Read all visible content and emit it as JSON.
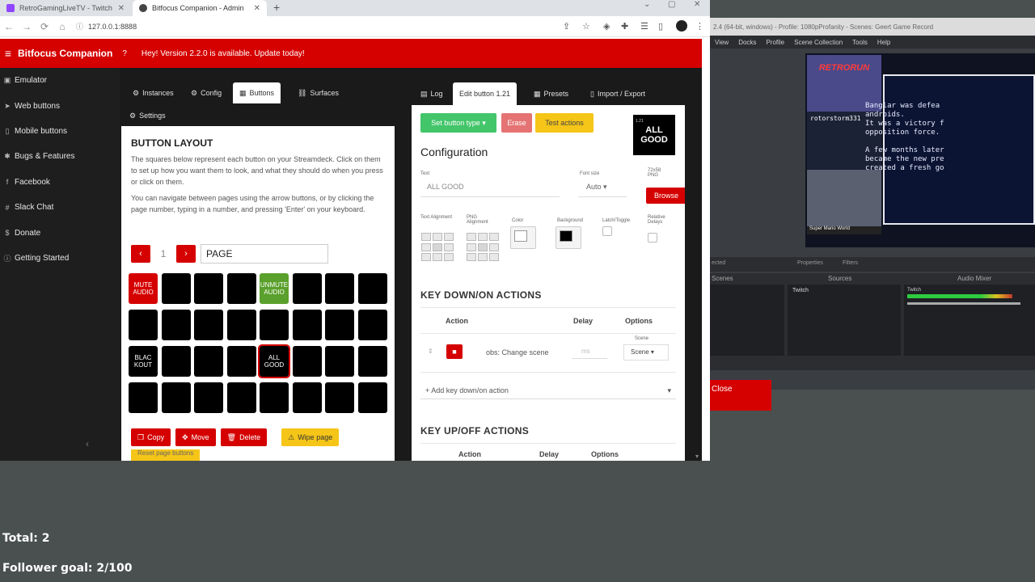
{
  "browser": {
    "tabs": [
      {
        "label": "RetroGamingLiveTV - Twitch",
        "favicon_color": "#9146ff"
      },
      {
        "label": "Bitfocus Companion - Admin",
        "favicon_color": "#444444"
      }
    ],
    "url": "127.0.0.1:8888"
  },
  "app": {
    "title": "Bitfocus Companion",
    "help": "?",
    "update_msg": "Hey! Version 2.2.0 is available. Update today!",
    "accent": "#d50000"
  },
  "sidebar": {
    "items": [
      {
        "label": "Emulator",
        "icon": "gamepad-icon"
      },
      {
        "label": "Web buttons",
        "icon": "pointer-icon"
      },
      {
        "label": "Mobile buttons",
        "icon": "mobile-icon"
      },
      {
        "label": "Bugs & Features",
        "icon": "bug-icon"
      },
      {
        "label": "Facebook",
        "icon": "facebook-icon"
      },
      {
        "label": "Slack Chat",
        "icon": "slack-icon"
      },
      {
        "label": "Donate",
        "icon": "dollar-icon"
      },
      {
        "label": "Getting Started",
        "icon": "info-icon"
      }
    ]
  },
  "left_tabs": {
    "instances": "Instances",
    "config": "Config",
    "buttons": "Buttons",
    "surfaces": "Surfaces",
    "settings": "Settings"
  },
  "button_layout": {
    "title": "BUTTON LAYOUT",
    "text1": "The squares below represent each button on your Streamdeck. Click on them to set up how you want them to look, and what they should do when you press or click on them.",
    "text2": "You can navigate between pages using the arrow buttons, or by clicking the page number, typing in a number, and pressing 'Enter' on your keyboard.",
    "page_number": "1",
    "page_name": "PAGE",
    "buttons": [
      {
        "label": "MUTE\nAUDIO",
        "bg": "#d50000"
      },
      {
        "label": "",
        "bg": "#000000"
      },
      {
        "label": "",
        "bg": "#000000"
      },
      {
        "label": "",
        "bg": "#000000"
      },
      {
        "label": "UNMUTE\nAUDIO",
        "bg": "#5aa02c"
      },
      {
        "label": "",
        "bg": "#000000"
      },
      {
        "label": "",
        "bg": "#000000"
      },
      {
        "label": "",
        "bg": "#000000"
      },
      {
        "label": "",
        "bg": "#000000"
      },
      {
        "label": "",
        "bg": "#000000"
      },
      {
        "label": "",
        "bg": "#000000"
      },
      {
        "label": "",
        "bg": "#000000"
      },
      {
        "label": "",
        "bg": "#000000"
      },
      {
        "label": "",
        "bg": "#000000"
      },
      {
        "label": "",
        "bg": "#000000"
      },
      {
        "label": "",
        "bg": "#000000"
      },
      {
        "label": "BLAC\nKOUT",
        "bg": "#000000"
      },
      {
        "label": "",
        "bg": "#000000"
      },
      {
        "label": "",
        "bg": "#000000"
      },
      {
        "label": "",
        "bg": "#000000"
      },
      {
        "label": "ALL\nGOOD",
        "bg": "#000000"
      },
      {
        "label": "",
        "bg": "#000000"
      },
      {
        "label": "",
        "bg": "#000000"
      },
      {
        "label": "",
        "bg": "#000000"
      },
      {
        "label": "",
        "bg": "#000000"
      },
      {
        "label": "",
        "bg": "#000000"
      },
      {
        "label": "",
        "bg": "#000000"
      },
      {
        "label": "",
        "bg": "#000000"
      },
      {
        "label": "",
        "bg": "#000000"
      },
      {
        "label": "",
        "bg": "#000000"
      },
      {
        "label": "",
        "bg": "#000000"
      },
      {
        "label": "",
        "bg": "#000000"
      }
    ],
    "copy": "Copy",
    "move": "Move",
    "delete": "Delete",
    "wipe": "Wipe page",
    "reset": "Reset page buttons"
  },
  "right_tabs": {
    "log": "Log",
    "edit": "Edit button 1.21",
    "presets": "Presets",
    "import_export": "Import / Export"
  },
  "editor": {
    "set_type": "Set button type",
    "erase": "Erase",
    "test": "Test actions",
    "preview_label": "ALL GOOD",
    "preview_small": "1.21",
    "heading": "Configuration",
    "text_label": "Text",
    "text_value": "ALL GOOD",
    "font_size_label": "Font size",
    "font_size_value": "Auto",
    "png_label": "72x58 PNG",
    "browse": "Browse",
    "text_alignment": "Text Alignment",
    "png_alignment": "PNG Alignment",
    "color_label": "Color",
    "background_label": "Background",
    "latch_label": "Latch/Toggle",
    "relative_label": "Relative Delays",
    "color_value": "#ffffff",
    "background_value": "#000000",
    "key_down_heading": "KEY DOWN/ON ACTIONS",
    "col_action": "Action",
    "col_delay": "Delay",
    "col_options": "Options",
    "action_name": "obs: Change scene",
    "delay_placeholder": "ms",
    "scene_label": "Scene",
    "scene_value": "Scene",
    "add_key_down": "+ Add key down/on action",
    "key_up_heading": "KEY UP/OFF ACTIONS"
  },
  "obs": {
    "title": "2.4 (64-bit, windows) - Profile: 1080pProfanity - Scenes: Geert Game Record",
    "menu": [
      "View",
      "Docks",
      "Profile",
      "Scene Collection",
      "Tools",
      "Help"
    ],
    "logo_text": "RETRORUN",
    "chat_user": "rotorstorm331",
    "game_text": "Banglar was defea\nandroids.\nIt was a victory f\nopposition force.\n\nA few months later\nbecame the new pre\ncreated a fresh go",
    "bottom_game": "Super Mario World",
    "docks": {
      "scenes": "Scenes",
      "sources": "Sources",
      "mixer": "Audio Mixer",
      "source_item": "Twitch",
      "mixer_item": "Twitch",
      "props": "Properties",
      "filters": "Filters",
      "selected": "ected"
    },
    "close": "Close"
  },
  "overlay": {
    "total": "Total: 2",
    "follower_goal": "Follower goal: 2/100"
  }
}
